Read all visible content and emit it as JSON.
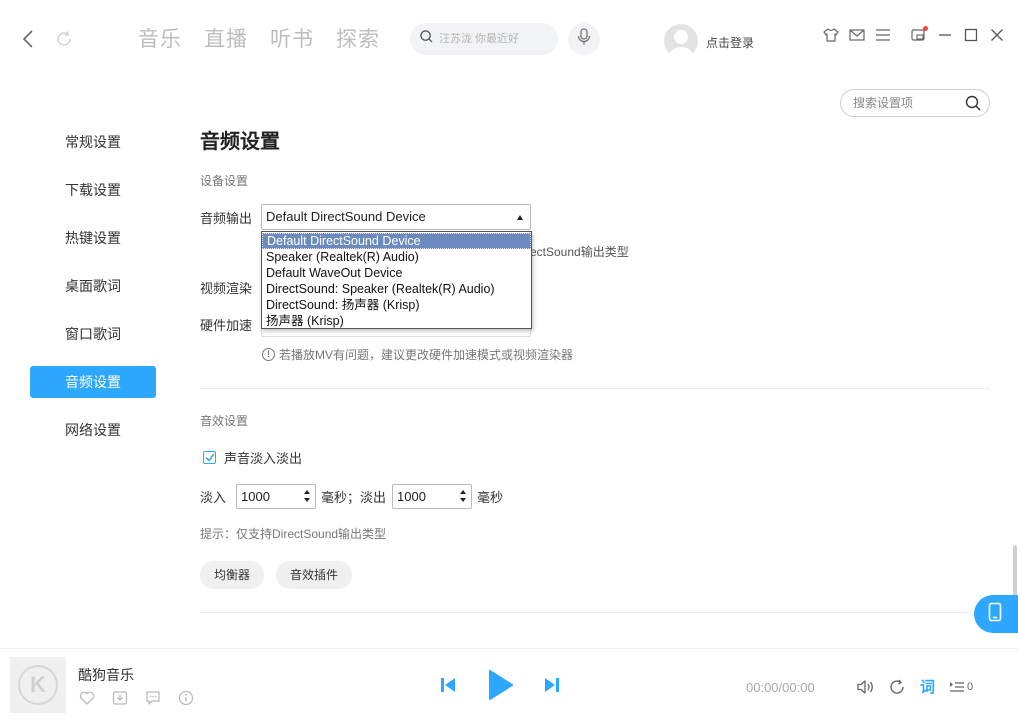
{
  "topbar": {
    "tabs": [
      "音乐",
      "直播",
      "听书",
      "探索"
    ],
    "search_placeholder": "汪苏泷 你最近好",
    "login_label": "点击登录"
  },
  "settings_search": {
    "placeholder": "搜索设置项"
  },
  "sidebar": {
    "items": [
      {
        "label": "常规设置",
        "active": false
      },
      {
        "label": "下载设置",
        "active": false
      },
      {
        "label": "热键设置",
        "active": false
      },
      {
        "label": "桌面歌词",
        "active": false
      },
      {
        "label": "窗口歌词",
        "active": false
      },
      {
        "label": "音频设置",
        "active": true
      },
      {
        "label": "网络设置",
        "active": false
      }
    ]
  },
  "page": {
    "title": "音频设置",
    "device_section": "设备设置",
    "audio_output_label": "音频输出",
    "audio_output_value": "Default DirectSound Device",
    "audio_output_options": [
      "Default DirectSound Device",
      "Speaker (Realtek(R) Audio)",
      "Default WaveOut Device",
      "DirectSound: Speaker (Realtek(R) Audio)",
      "DirectSound: 扬声器 (Krisp)",
      "扬声器 (Krisp)"
    ],
    "hint_behind_dropdown": "rectSound输出类型",
    "video_render_label": "视频渲染",
    "hw_accel_label": "硬件加速",
    "mv_hint": "若播放MV有问题，建议更改硬件加速模式或视频渲染器",
    "effects_section": "音效设置",
    "fade_checkbox_label": "声音淡入淡出",
    "fade_checked": true,
    "fade_in_label": "淡入",
    "fade_in_value": "1000",
    "ms_label_1": "毫秒；淡出",
    "fade_out_value": "1000",
    "ms_label_2": "毫秒",
    "ds_hint": "提示：仅支持DirectSound输出类型",
    "equalizer_label": "均衡器",
    "plugins_label": "音效插件"
  },
  "player": {
    "song_title": "酷狗音乐",
    "logo_letter": "K",
    "time": "00:00/00:00",
    "lyric_label": "词",
    "queue_count": "0"
  },
  "colors": {
    "accent": "#2ea7ff",
    "selected_option": "#6b8bbf"
  }
}
